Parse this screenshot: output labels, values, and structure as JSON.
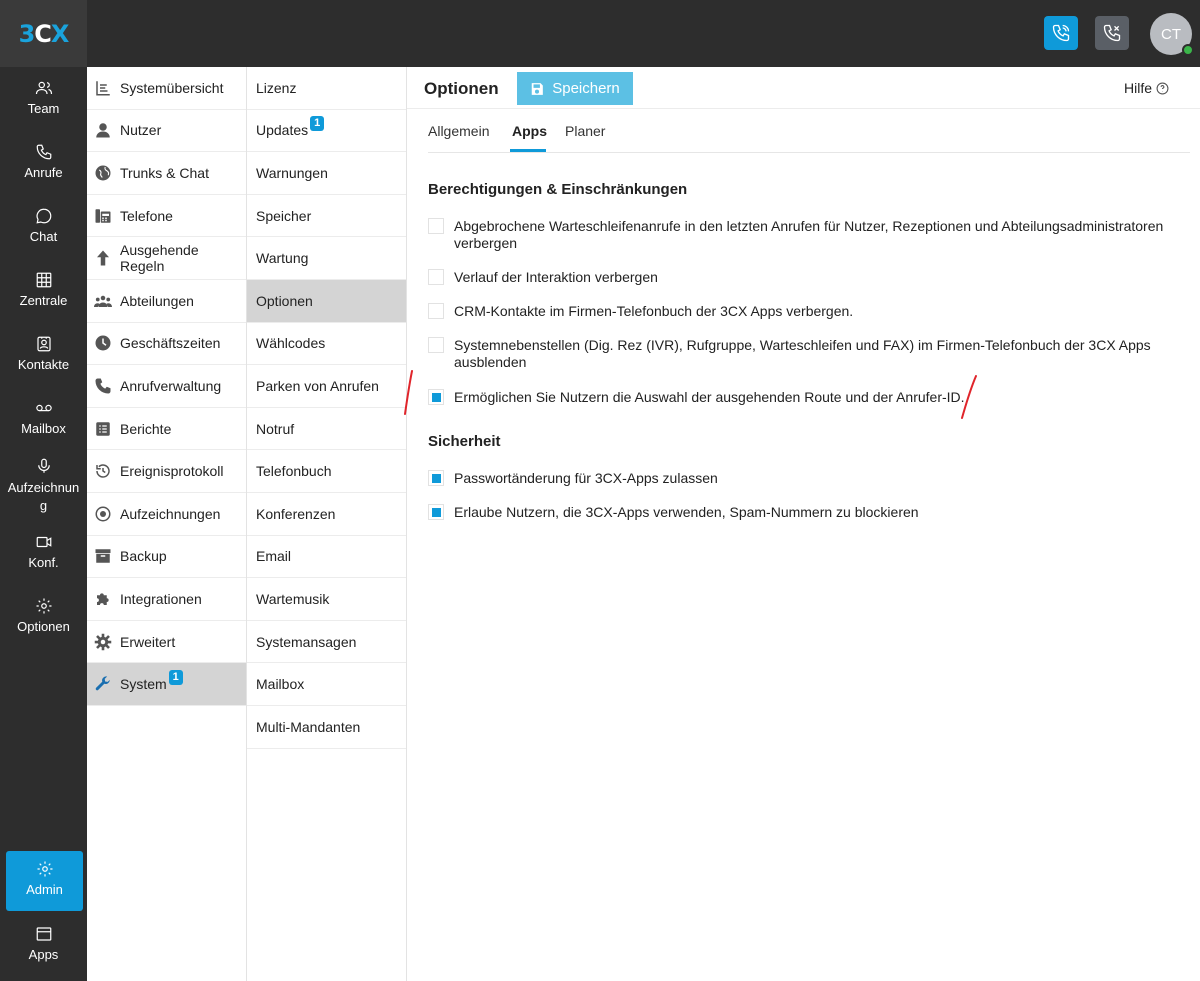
{
  "colors": {
    "accent": "#0f9ad9",
    "topbar": "#2d2d2d",
    "active_bg": "#d4d4d4",
    "annotation": "#e0252b"
  },
  "app": {
    "logo": "3CX",
    "avatar_initials": "CT"
  },
  "leftnav": {
    "items": [
      {
        "label": "Team",
        "icon": "team-icon"
      },
      {
        "label": "Anrufe",
        "icon": "phone-icon"
      },
      {
        "label": "Chat",
        "icon": "chat-icon"
      },
      {
        "label": "Zentrale",
        "icon": "grid-icon"
      },
      {
        "label": "Kontakte",
        "icon": "contacts-icon"
      },
      {
        "label": "Mailbox",
        "icon": "voicemail-icon"
      },
      {
        "label": "Aufzeichnun",
        "label2": "g",
        "icon": "microphone-icon"
      },
      {
        "label": "Konf.",
        "icon": "video-icon"
      },
      {
        "label": "Optionen",
        "icon": "gear-icon"
      }
    ],
    "admin": {
      "label": "Admin",
      "icon": "gear-icon"
    },
    "apps": {
      "label": "Apps",
      "icon": "apps-window-icon"
    }
  },
  "col1": {
    "items": [
      {
        "label": "Systemübersicht",
        "icon": "dashboard-icon"
      },
      {
        "label": "Nutzer",
        "icon": "user-icon"
      },
      {
        "label": "Trunks & Chat",
        "icon": "globe-icon"
      },
      {
        "label": "Telefone",
        "icon": "fax-phone-icon"
      },
      {
        "label": "Ausgehende Regeln",
        "icon": "arrow-up-icon"
      },
      {
        "label": "Abteilungen",
        "icon": "group-icon"
      },
      {
        "label": "Geschäftszeiten",
        "icon": "clock-icon"
      },
      {
        "label": "Anrufverwaltung",
        "icon": "phone-icon"
      },
      {
        "label": "Berichte",
        "icon": "report-icon"
      },
      {
        "label": "Ereignisprotokoll",
        "icon": "history-icon"
      },
      {
        "label": "Aufzeichnungen",
        "icon": "record-icon"
      },
      {
        "label": "Backup",
        "icon": "archive-icon"
      },
      {
        "label": "Integrationen",
        "icon": "puzzle-icon"
      },
      {
        "label": "Erweitert",
        "icon": "gear-icon"
      },
      {
        "label": "System",
        "icon": "wrench-icon",
        "badge": "1"
      }
    ]
  },
  "col2": {
    "items": [
      {
        "label": "Lizenz"
      },
      {
        "label": "Updates",
        "badge": "1"
      },
      {
        "label": "Warnungen"
      },
      {
        "label": "Speicher"
      },
      {
        "label": "Wartung"
      },
      {
        "label": "Optionen"
      },
      {
        "label": "Wählcodes"
      },
      {
        "label": "Parken von Anrufen"
      },
      {
        "label": "Notruf"
      },
      {
        "label": "Telefonbuch"
      },
      {
        "label": "Konferenzen"
      },
      {
        "label": "Email"
      },
      {
        "label": "Wartemusik"
      },
      {
        "label": "Systemansagen"
      },
      {
        "label": "Mailbox"
      },
      {
        "label": "Multi-Mandanten"
      }
    ]
  },
  "main": {
    "title": "Optionen",
    "save_label": "Speichern",
    "help_label": "Hilfe",
    "tabs": [
      {
        "label": "Allgemein"
      },
      {
        "label": "Apps"
      },
      {
        "label": "Planer"
      }
    ],
    "sections": [
      {
        "title": "Berechtigungen & Einschränkungen",
        "options": [
          {
            "label": "Abgebrochene Warteschleifenanrufe in den letzten Anrufen für Nutzer, Rezeptionen und Abteilungsadministratoren verbergen",
            "checked": false
          },
          {
            "label": "Verlauf der Interaktion verbergen",
            "checked": false
          },
          {
            "label": "CRM-Kontakte im Firmen-Telefonbuch der 3CX Apps verbergen.",
            "checked": false
          },
          {
            "label": "Systemnebenstellen (Dig. Rez (IVR), Rufgruppe, Warteschleifen und FAX) im Firmen-Telefonbuch der 3CX Apps ausblenden",
            "checked": false
          },
          {
            "label": "Ermöglichen Sie Nutzern die Auswahl der ausgehenden Route und der Anrufer-ID.",
            "checked": true
          }
        ]
      },
      {
        "title": "Sicherheit",
        "options": [
          {
            "label": "Passwortänderung für 3CX-Apps zulassen",
            "checked": true
          },
          {
            "label": "Erlaube Nutzern, die 3CX-Apps verwenden, Spam-Nummern zu blockieren",
            "checked": true
          }
        ]
      }
    ]
  }
}
